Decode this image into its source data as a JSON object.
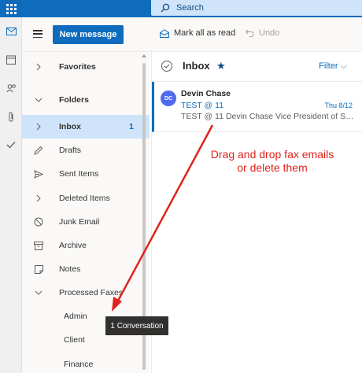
{
  "topbar": {
    "search_placeholder": "Search"
  },
  "rail": {
    "items": [
      "mail-icon",
      "calendar-icon",
      "people-icon",
      "attach-icon",
      "todo-icon"
    ]
  },
  "commands": {
    "new_message": "New message",
    "mark_all_read": "Mark all as read",
    "undo": "Undo"
  },
  "folders": {
    "favorites": "Favorites",
    "folders": "Folders",
    "inbox": "Inbox",
    "inbox_count": "1",
    "drafts": "Drafts",
    "sent": "Sent Items",
    "deleted": "Deleted Items",
    "junk": "Junk Email",
    "archive": "Archive",
    "notes": "Notes",
    "processed": "Processed Faxes",
    "admin": "Admin",
    "client": "Client",
    "finance": "Finance"
  },
  "tooltip": "1 Conversation",
  "list": {
    "title": "Inbox",
    "filter": "Filter ⌵"
  },
  "message": {
    "initials": "DC",
    "sender": "Devin Chase",
    "subject": "TEST @ 11",
    "date": "Thu 8/12",
    "preview": "TEST @ 11 Devin Chase Vice President of Sal..."
  },
  "annotation": {
    "line1": "Drag and drop fax emails",
    "line2": "or delete them"
  },
  "colors": {
    "brand": "#0f6cbd",
    "selected": "#cfe4fa",
    "annotation": "#e0231c"
  }
}
